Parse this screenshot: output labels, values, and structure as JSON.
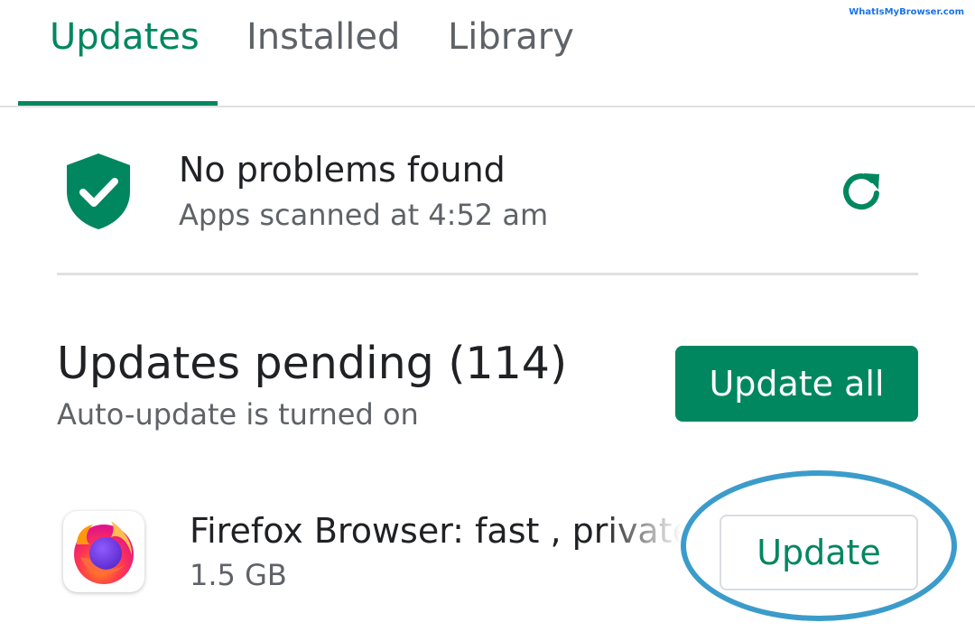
{
  "watermark": "WhatIsMyBrowser.com",
  "tabs": [
    {
      "label": "Updates",
      "active": true
    },
    {
      "label": "Installed",
      "active": false
    },
    {
      "label": "Library",
      "active": false
    }
  ],
  "scan": {
    "title": "No problems found",
    "subtitle": "Apps scanned at 4:52 am",
    "icon": "shield-check-icon",
    "refresh_icon": "refresh-icon"
  },
  "pending": {
    "title": "Updates pending (114)",
    "subtitle": "Auto-update is turned on",
    "update_all_label": "Update all"
  },
  "apps": [
    {
      "name": "Firefox Browser: fast , private & safe web browser",
      "size": "1.5 GB",
      "update_label": "Update",
      "icon": "firefox-icon"
    }
  ],
  "colors": {
    "accent": "#01875f",
    "highlight_ring": "#3b9ccb",
    "secondary_text": "#5f6368"
  }
}
